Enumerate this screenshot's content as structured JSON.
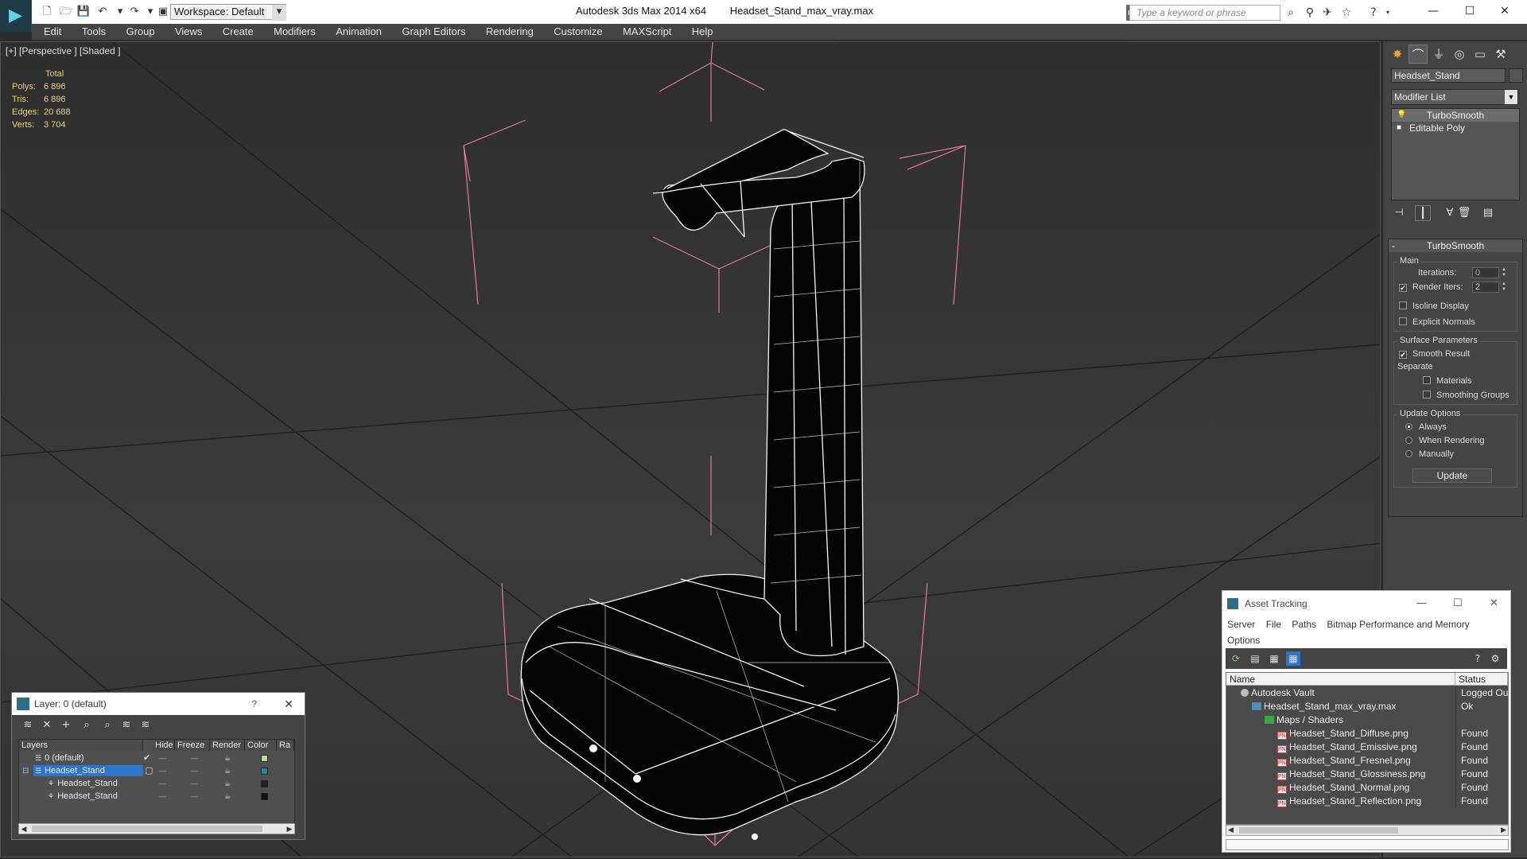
{
  "titlebar": {
    "workspace": "Workspace: Default",
    "app": "Autodesk 3ds Max  2014 x64",
    "file": "Headset_Stand_max_vray.max",
    "search_placeholder": "Type a keyword or phrase"
  },
  "menu": [
    "Edit",
    "Tools",
    "Group",
    "Views",
    "Create",
    "Modifiers",
    "Animation",
    "Graph Editors",
    "Rendering",
    "Customize",
    "MAXScript",
    "Help"
  ],
  "viewport": {
    "label": "[+] [Perspective ] [Shaded ]",
    "stats": {
      "total_label": "Total",
      "rows": [
        {
          "label": "Polys:",
          "value": "6 896"
        },
        {
          "label": "Tris:",
          "value": "6 896"
        },
        {
          "label": "Edges:",
          "value": "20 688"
        },
        {
          "label": "Verts:",
          "value": "3 704"
        }
      ]
    }
  },
  "command_panel": {
    "object_name": "Headset_Stand",
    "modifier_list": "Modifier List",
    "stack": [
      {
        "label": "TurboSmooth",
        "selected": true
      },
      {
        "label": "Editable Poly",
        "selected": false
      }
    ],
    "rollout_title": "TurboSmooth",
    "main_label": "Main",
    "iterations_label": "Iterations:",
    "iterations_value": "0",
    "render_iters_label": "Render Iters:",
    "render_iters_value": "2",
    "isoline": "Isoline Display",
    "explicit_normals": "Explicit Normals",
    "surface_params_label": "Surface Parameters",
    "smooth_result": "Smooth Result",
    "separate_label": "Separate",
    "materials": "Materials",
    "smoothing_groups": "Smoothing Groups",
    "update_options_label": "Update Options",
    "always": "Always",
    "when_rendering": "When Rendering",
    "manually": "Manually",
    "update_button": "Update"
  },
  "layer_dialog": {
    "title": "Layer: 0 (default)",
    "help": "?",
    "columns": [
      "Layers",
      "Hide",
      "Freeze",
      "Render",
      "Color",
      "Ra"
    ],
    "rows": [
      {
        "name": "0 (default)",
        "indent": 0,
        "color": "#b8e08a",
        "selected": false,
        "check": "✔"
      },
      {
        "name": "Headset_Stand",
        "indent": 0,
        "color": "#1a8aa6",
        "selected": true,
        "check": "▢"
      },
      {
        "name": "Headset_Stand",
        "indent": 1,
        "color": "#222222",
        "selected": false,
        "check": ""
      },
      {
        "name": "Headset_Stand",
        "indent": 1,
        "color": "#111111",
        "selected": false,
        "check": ""
      }
    ]
  },
  "asset_tracking": {
    "title": "Asset Tracking",
    "menu": [
      "Server",
      "File",
      "Paths",
      "Bitmap Performance and Memory",
      "Options"
    ],
    "col_name": "Name",
    "col_status": "Status",
    "rows": [
      {
        "name": "Autodesk Vault",
        "status": "Logged Out",
        "indent": 0,
        "icon": "vault"
      },
      {
        "name": "Headset_Stand_max_vray.max",
        "status": "Ok",
        "indent": 1,
        "icon": "max"
      },
      {
        "name": "Maps / Shaders",
        "status": "",
        "indent": 2,
        "icon": "map"
      },
      {
        "name": "Headset_Stand_Diffuse.png",
        "status": "Found",
        "indent": 3,
        "icon": "png"
      },
      {
        "name": "Headset_Stand_Emissive.png",
        "status": "Found",
        "indent": 3,
        "icon": "png"
      },
      {
        "name": "Headset_Stand_Fresnel.png",
        "status": "Found",
        "indent": 3,
        "icon": "png"
      },
      {
        "name": "Headset_Stand_Glossiness.png",
        "status": "Found",
        "indent": 3,
        "icon": "png"
      },
      {
        "name": "Headset_Stand_Normal.png",
        "status": "Found",
        "indent": 3,
        "icon": "png"
      },
      {
        "name": "Headset_Stand_Reflection.png",
        "status": "Found",
        "indent": 3,
        "icon": "png"
      }
    ]
  }
}
